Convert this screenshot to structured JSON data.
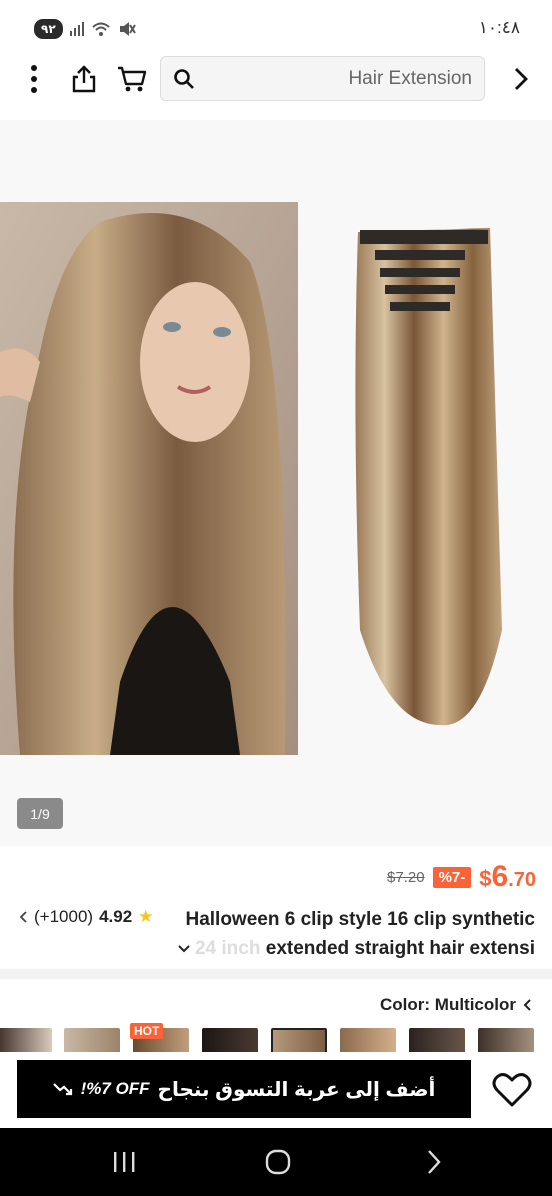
{
  "status_bar": {
    "battery": "٩٢",
    "time": "١٠:٤٨",
    "icons": [
      "signal-icon",
      "wifi-icon",
      "mute-icon"
    ]
  },
  "nav": {
    "search_text": "Hair Extension",
    "icons": [
      "more-vertical-icon",
      "share-icon",
      "cart-icon",
      "search-icon",
      "forward-arrow-icon"
    ]
  },
  "gallery": {
    "indicator": "1/9"
  },
  "price": {
    "old": "$7.20",
    "discount": "%7-",
    "currency": "$",
    "integer": "6",
    "decimal": ".70"
  },
  "product": {
    "title_line1": "Halloween 6 clip style 16 clip synthetic",
    "title_line2_faded": "24 inch",
    "title_line2": " extended straight hair extensi"
  },
  "rating": {
    "score": "4.92",
    "count": "(+1000)"
  },
  "color": {
    "label": "Color: Multicolor"
  },
  "swatches": {
    "hot_tag": "HOT"
  },
  "action_bar": {
    "add_to_cart": "أضف إلى عربة التسوق بنجاح",
    "promo": "!%7 OFF"
  },
  "colors": {
    "accent": "#fa6338",
    "star": "#f8c51c",
    "primary_button": "#000000"
  }
}
